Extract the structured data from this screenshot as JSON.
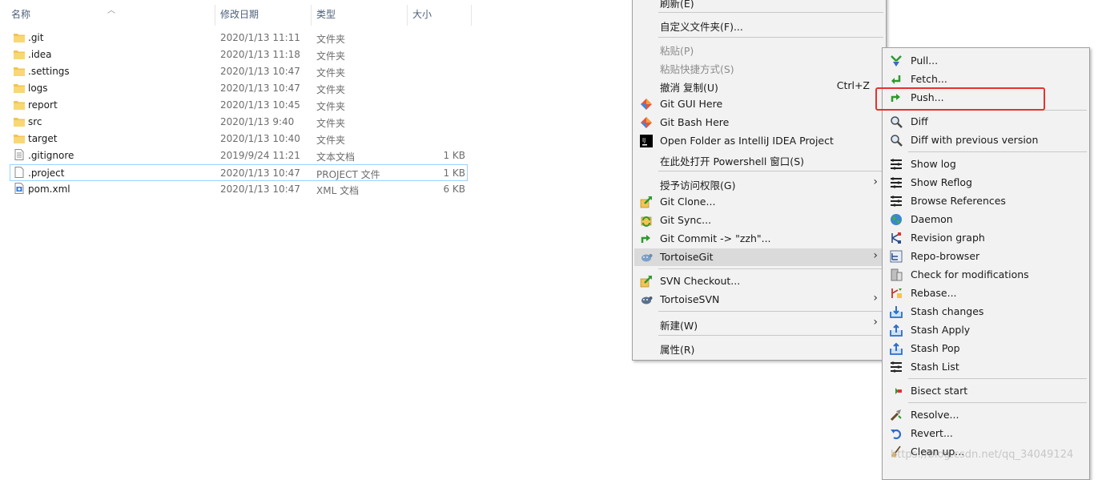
{
  "explorer": {
    "columns": [
      {
        "label": "名称"
      },
      {
        "label": "修改日期"
      },
      {
        "label": "类型"
      },
      {
        "label": "大小"
      }
    ],
    "files": [
      {
        "name": ".git",
        "date": "2020/1/13 11:11",
        "type": "文件夹",
        "size": "",
        "icon": "folder-icon"
      },
      {
        "name": ".idea",
        "date": "2020/1/13 11:18",
        "type": "文件夹",
        "size": "",
        "icon": "folder-icon"
      },
      {
        "name": ".settings",
        "date": "2020/1/13 10:47",
        "type": "文件夹",
        "size": "",
        "icon": "folder-icon"
      },
      {
        "name": "logs",
        "date": "2020/1/13 10:47",
        "type": "文件夹",
        "size": "",
        "icon": "folder-icon"
      },
      {
        "name": "report",
        "date": "2020/1/13 10:45",
        "type": "文件夹",
        "size": "",
        "icon": "folder-icon"
      },
      {
        "name": "src",
        "date": "2020/1/13 9:40",
        "type": "文件夹",
        "size": "",
        "icon": "folder-icon"
      },
      {
        "name": "target",
        "date": "2020/1/13 10:40",
        "type": "文件夹",
        "size": "",
        "icon": "folder-icon"
      },
      {
        "name": ".gitignore",
        "date": "2019/9/24 11:21",
        "type": "文本文档",
        "size": "1 KB",
        "icon": "text-file-icon"
      },
      {
        "name": ".project",
        "date": "2020/1/13 10:47",
        "type": "PROJECT 文件",
        "size": "1 KB",
        "icon": "blank-file-icon"
      },
      {
        "name": "pom.xml",
        "date": "2020/1/13 10:47",
        "type": "XML 文档",
        "size": "6 KB",
        "icon": "xml-file-icon"
      }
    ]
  },
  "context_menu": {
    "items": [
      {
        "label": "刷新(E)"
      },
      {
        "label": "自定义文件夹(F)..."
      },
      {
        "label": "粘贴(P)"
      },
      {
        "label": "粘贴快捷方式(S)"
      },
      {
        "label": "撤消 复制(U)",
        "shortcut": "Ctrl+Z"
      },
      {
        "label": "Git GUI Here"
      },
      {
        "label": "Git Bash Here"
      },
      {
        "label": "Open Folder as IntelliJ IDEA Project"
      },
      {
        "label": "在此处打开 Powershell 窗口(S)"
      },
      {
        "label": "授予访问权限(G)"
      },
      {
        "label": "Git Clone..."
      },
      {
        "label": "Git Sync..."
      },
      {
        "label": "Git Commit -> \"zzh\"..."
      },
      {
        "label": "TortoiseGit"
      },
      {
        "label": "SVN Checkout..."
      },
      {
        "label": "TortoiseSVN"
      },
      {
        "label": "新建(W)"
      },
      {
        "label": "属性(R)"
      }
    ]
  },
  "tortoisegit_submenu": {
    "items": [
      {
        "label": "Pull..."
      },
      {
        "label": "Fetch..."
      },
      {
        "label": "Push..."
      },
      {
        "label": "Diff"
      },
      {
        "label": "Diff with previous version"
      },
      {
        "label": "Show log"
      },
      {
        "label": "Show Reflog"
      },
      {
        "label": "Browse References"
      },
      {
        "label": "Daemon"
      },
      {
        "label": "Revision graph"
      },
      {
        "label": "Repo-browser"
      },
      {
        "label": "Check for modifications"
      },
      {
        "label": "Rebase..."
      },
      {
        "label": "Stash changes"
      },
      {
        "label": "Stash Apply"
      },
      {
        "label": "Stash Pop"
      },
      {
        "label": "Stash List"
      },
      {
        "label": "Bisect start"
      },
      {
        "label": "Resolve..."
      },
      {
        "label": "Revert..."
      },
      {
        "label": "Clean up..."
      }
    ]
  },
  "watermark": "https://blog.csdn.net/qq_34049124",
  "colors": {
    "highlight_border": "#e8312f",
    "folder": "#f3c451",
    "selection_border": "#99d1ff",
    "menu_bg": "#f2f2f2",
    "menu_hover": "#dadada"
  }
}
